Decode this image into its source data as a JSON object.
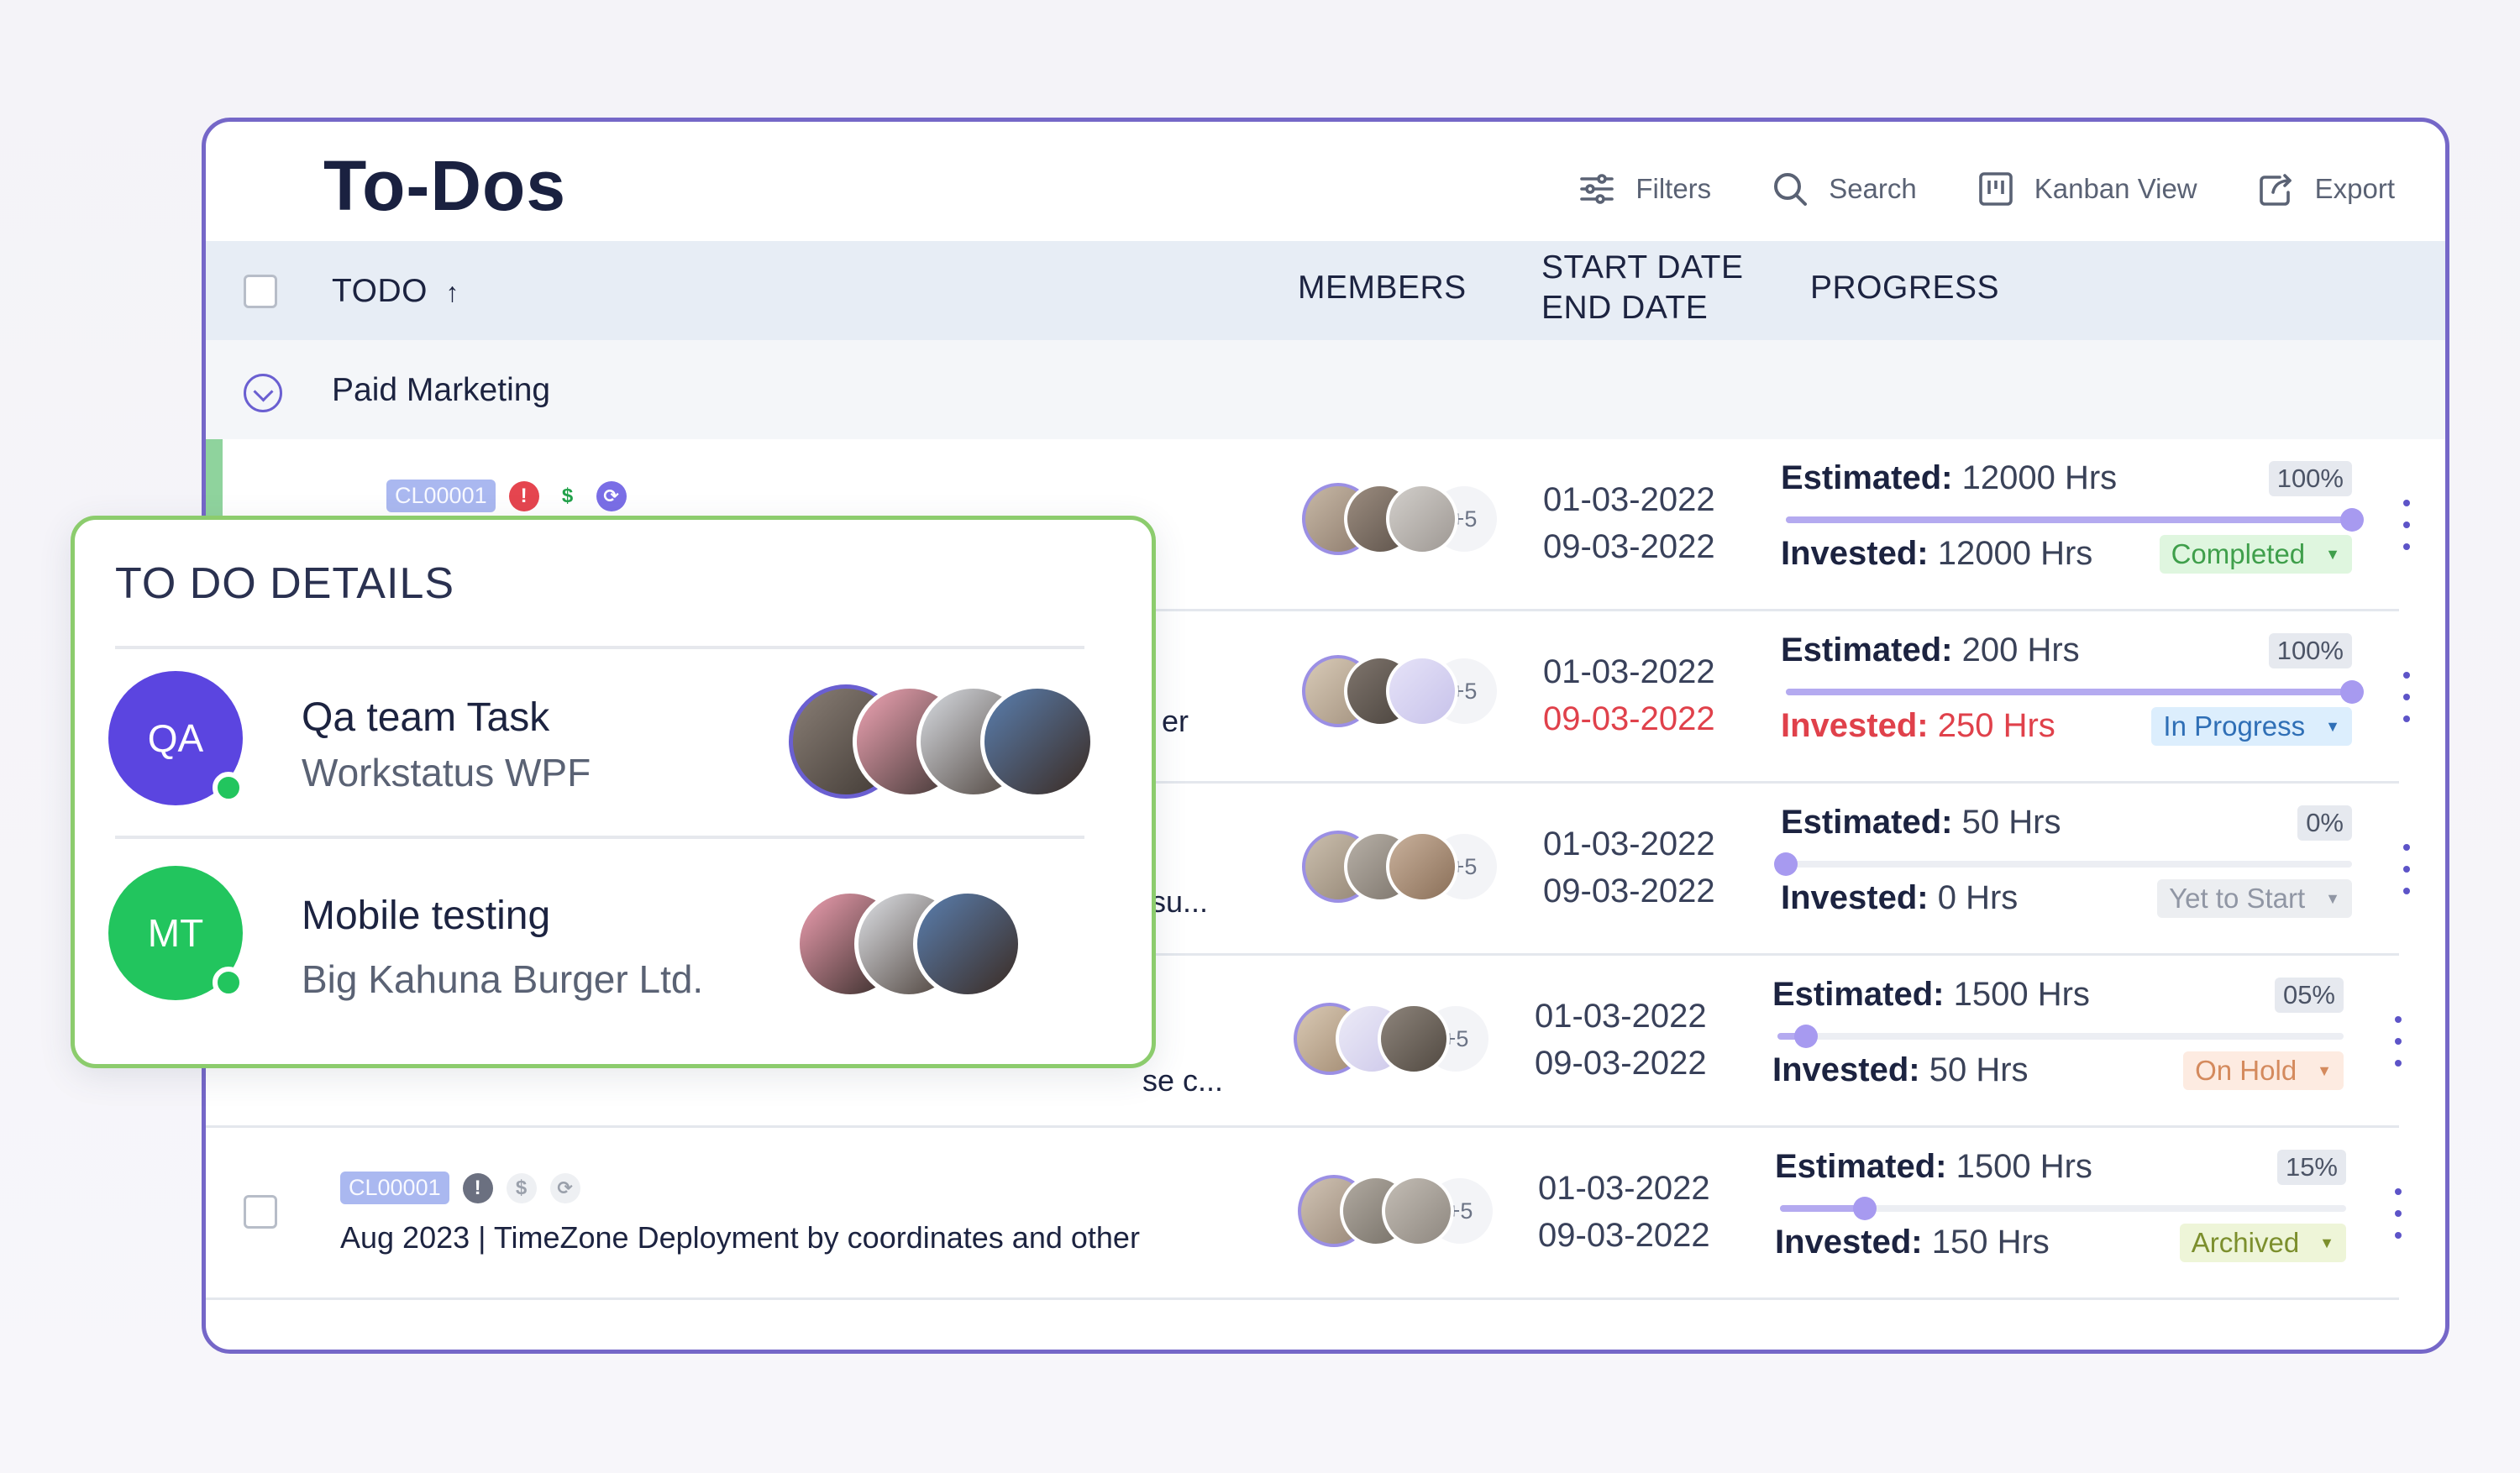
{
  "title": "To-Dos",
  "toolbar": {
    "filters": "Filters",
    "search": "Search",
    "kanban": "Kanban View",
    "export": "Export"
  },
  "table": {
    "col_todo": "TODO",
    "col_todo_sort": "↑",
    "col_members": "MEMBERS",
    "col_start": "START DATE",
    "col_end": "END DATE",
    "col_progress": "PROGRESS"
  },
  "group": {
    "label": "Paid Marketing"
  },
  "rows": [
    {
      "estimated_label": "Estimated:",
      "estimated": "12000 Hrs",
      "invested_label": "Invested:",
      "invested": "12000 Hrs",
      "percent": "100%",
      "progress": 1.0,
      "status": "Completed",
      "start": "01-03-2022",
      "end": "09-03-2022",
      "more": "+5"
    },
    {
      "text_partial": "er",
      "estimated_label": "Estimated:",
      "estimated": "200 Hrs",
      "invested_label": "Invested:",
      "invested": "250 Hrs",
      "percent": "100%",
      "progress": 1.0,
      "status": "In Progress",
      "start": "01-03-2022",
      "end": "09-03-2022",
      "more": "+5"
    },
    {
      "text_partial": "su...",
      "estimated_label": "Estimated:",
      "estimated": "50 Hrs",
      "invested_label": "Invested:",
      "invested": "0 Hrs",
      "percent": "0%",
      "progress": 0.0,
      "status": "Yet to Start",
      "start": "01-03-2022",
      "end": "09-03-2022",
      "more": "+5"
    },
    {
      "text_partial": "se c...",
      "estimated_label": "Estimated:",
      "estimated": "1500 Hrs",
      "invested_label": "Invested:",
      "invested": "50 Hrs",
      "percent": "05%",
      "progress": 0.05,
      "status": "On Hold",
      "start": "01-03-2022",
      "end": "09-03-2022",
      "more": "+5"
    },
    {
      "code": "CL00001",
      "text": "Aug 2023 | TimeZone Deployment by coordinates and other",
      "estimated_label": "Estimated:",
      "estimated": "1500 Hrs",
      "invested_label": "Invested:",
      "invested": "150 Hrs",
      "percent": "15%",
      "progress": 0.15,
      "status": "Archived",
      "start": "01-03-2022",
      "end": "09-03-2022",
      "more": "+5"
    }
  ],
  "first_row_code": "CL00001",
  "overlay": {
    "title": "TO DO DETAILS",
    "items": [
      {
        "initials": "QA",
        "name": "Qa team Task",
        "org": "Workstatus WPF"
      },
      {
        "initials": "MT",
        "name": "Mobile testing",
        "org": "Big Kahuna Burger Ltd."
      }
    ]
  },
  "colors": {
    "accent": "#7567c8",
    "qa_avatar": "#5b45e0",
    "mt_avatar": "#22c55e",
    "overlay_border": "#8ccc6d"
  },
  "icons": [
    "filters-icon",
    "search-icon",
    "kanban-icon",
    "export-icon",
    "alert-icon",
    "dollar-icon",
    "sync-icon",
    "chevron-down-icon",
    "more-vertical-icon"
  ]
}
